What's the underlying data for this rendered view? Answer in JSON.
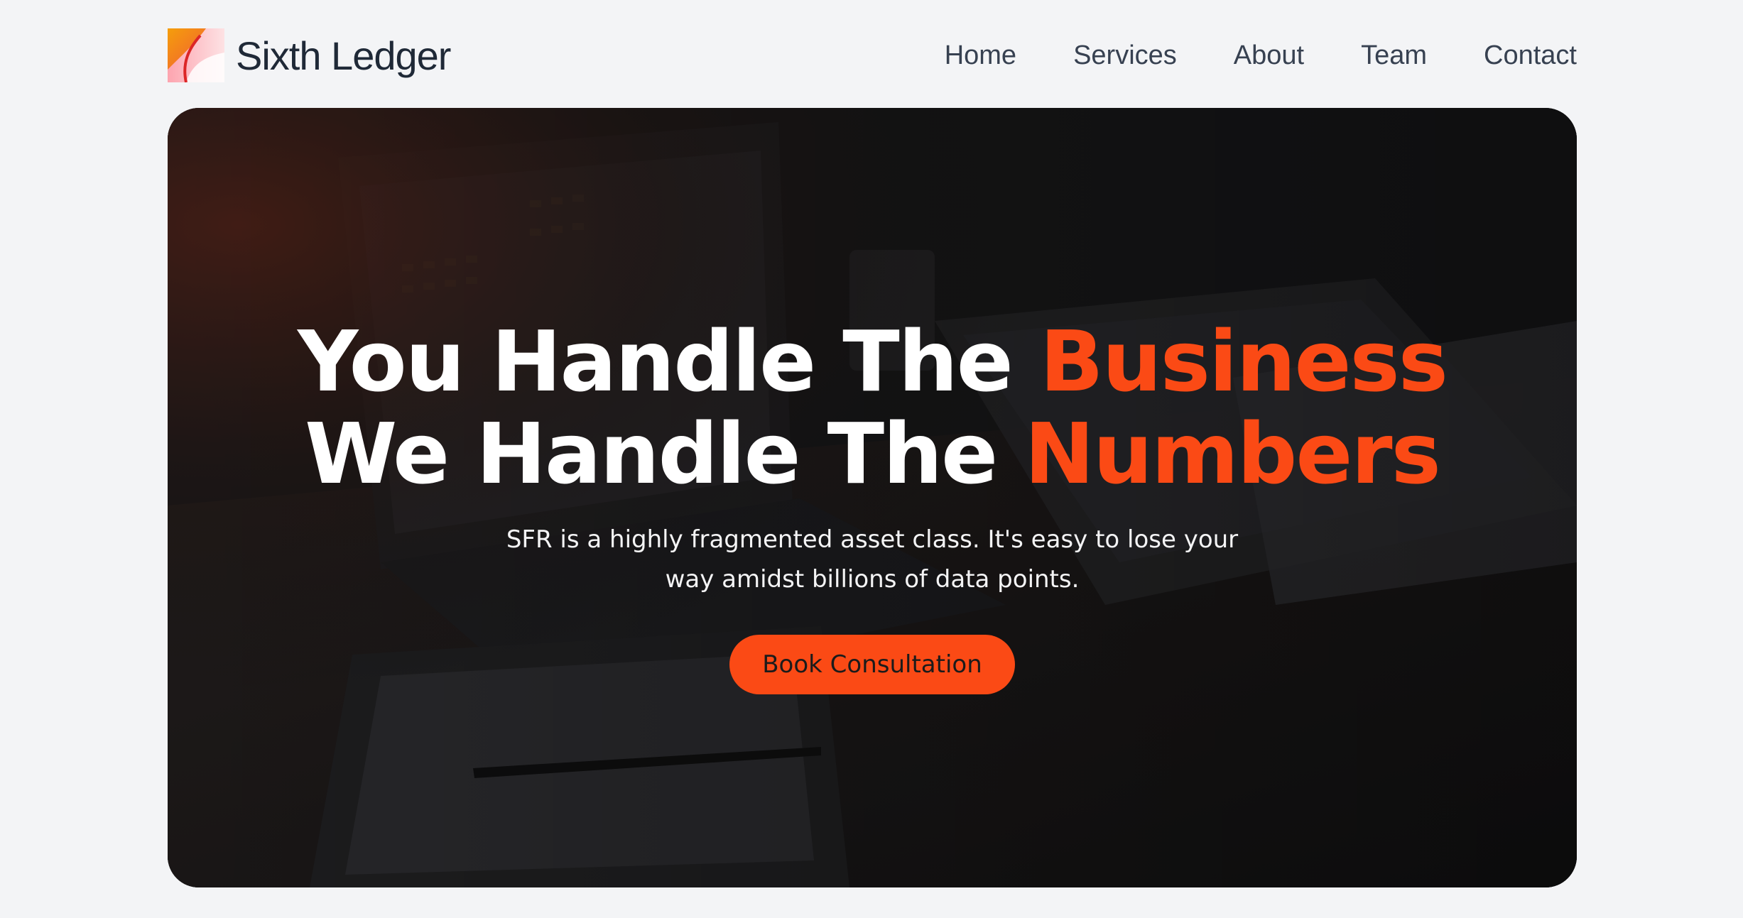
{
  "brand": {
    "name": "Sixth Ledger",
    "logo_icon": "sixth-ledger-logo"
  },
  "nav": {
    "items": [
      {
        "label": "Home"
      },
      {
        "label": "Services"
      },
      {
        "label": "About"
      },
      {
        "label": "Team"
      },
      {
        "label": "Contact"
      }
    ]
  },
  "hero": {
    "line1_prefix": "You Handle The ",
    "line1_accent": "Business",
    "line2_prefix": "We Handle The ",
    "line2_accent": "Numbers",
    "subtitle": "SFR is a highly fragmented asset class. It's easy to lose your way amidst billions of data points.",
    "cta_label": "Book Consultation",
    "background": "dark desk photo with laptop, notebook and pen"
  },
  "colors": {
    "accent": "#fb4a15",
    "page_bg": "#f3f4f6",
    "text_dark": "#1f2937"
  }
}
